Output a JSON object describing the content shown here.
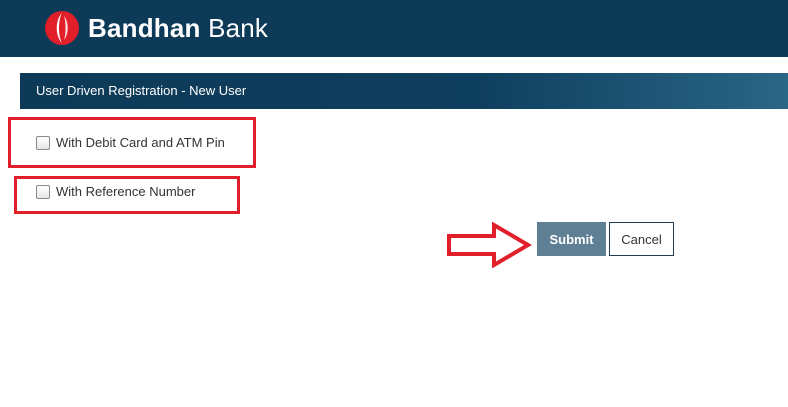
{
  "header": {
    "brand_bold": "Bandhan",
    "brand_light": "Bank",
    "logo_icon": "bandhan-logo-icon",
    "background_color": "#0d3a57"
  },
  "section": {
    "title": "User Driven Registration - New User"
  },
  "options": [
    {
      "label": "With Debit Card and ATM Pin",
      "checked": false
    },
    {
      "label": "With Reference Number",
      "checked": false
    }
  ],
  "actions": {
    "submit_label": "Submit",
    "cancel_label": "Cancel",
    "submit_color": "#5f7f95"
  },
  "annotations": {
    "highlight_color": "#e01f2b",
    "arrow_icon": "red-outline-arrow-right-icon"
  }
}
